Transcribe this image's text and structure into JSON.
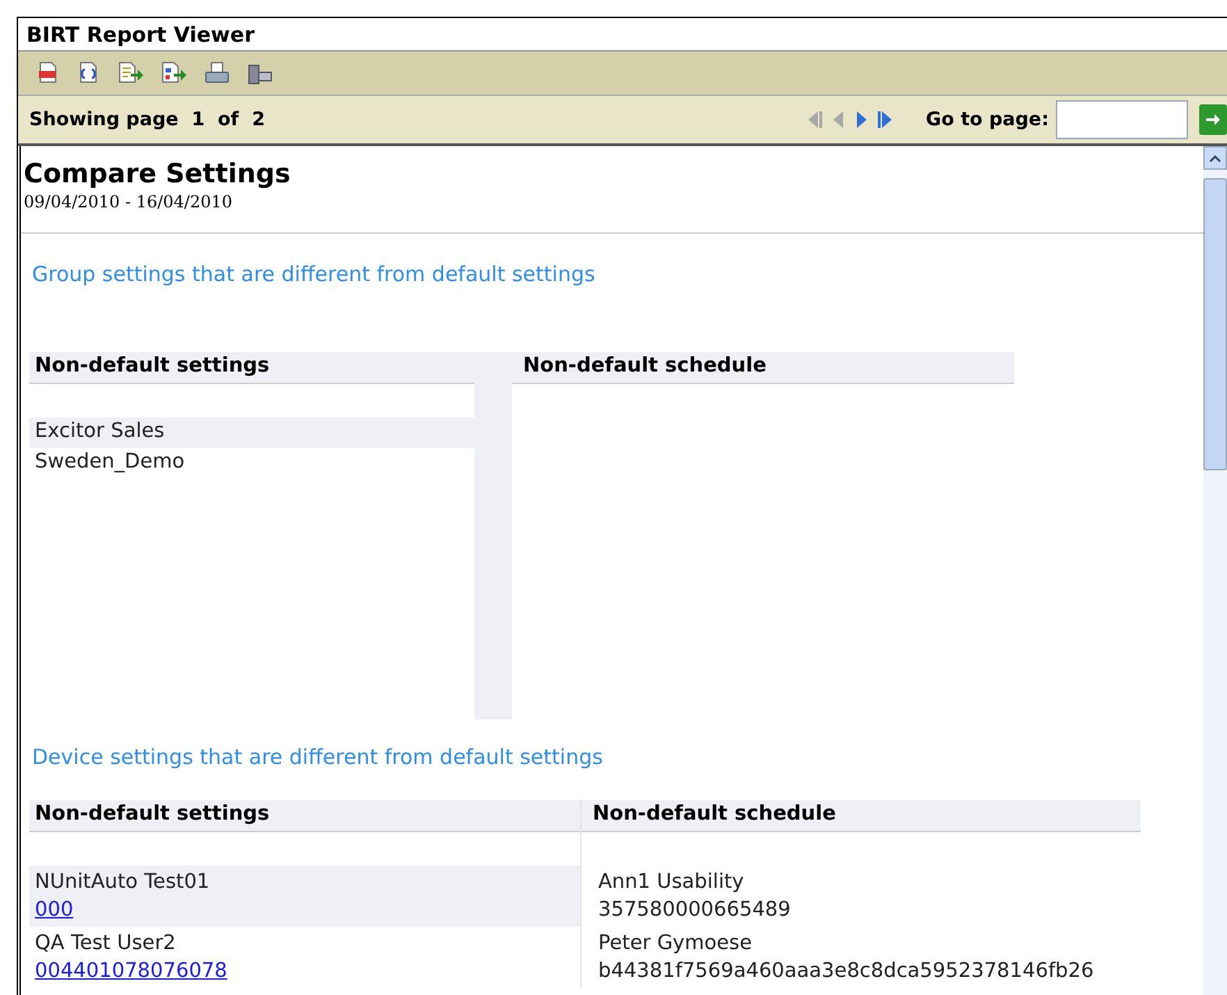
{
  "window": {
    "title": "BIRT Report Viewer"
  },
  "toolbar": [
    {
      "kind": "toc"
    },
    {
      "kind": "parameters"
    },
    {
      "kind": "export-data"
    },
    {
      "kind": "export-report"
    },
    {
      "kind": "print"
    },
    {
      "kind": "print-server"
    }
  ],
  "navigation": {
    "showing": "Showing page",
    "page": "1",
    "of": "of",
    "total": "2",
    "buttons": [
      {
        "kind": "first",
        "disabled": true
      },
      {
        "kind": "previous",
        "disabled": true
      },
      {
        "kind": "next",
        "disabled": false
      },
      {
        "kind": "last",
        "disabled": false
      }
    ],
    "goto_label": "Go to page:"
  },
  "report": {
    "title": "Compare Settings",
    "dates": "09/04/2010 - 16/04/2010",
    "sections": [
      {
        "heading": "Group settings that are different from default settings",
        "kind": "group",
        "columns": [
          "Non-default settings",
          "Non-default schedule"
        ],
        "rows": [
          {
            "cells": [
              {
                "lines": [
                  {
                    "text": "Excitor Sales",
                    "link": false
                  }
                ]
              }
            ]
          },
          {
            "cells": [
              {
                "lines": [
                  {
                    "text": "Sweden_Demo",
                    "link": false
                  }
                ]
              }
            ]
          }
        ]
      },
      {
        "heading": "Device settings that are different from default settings",
        "kind": "device",
        "columns": [
          "Non-default settings",
          "Non-default schedule"
        ],
        "rows": [
          {
            "cells": [
              {
                "lines": [
                  {
                    "text": "NUnitAuto Test01",
                    "link": false
                  },
                  {
                    "text": "000",
                    "link": true
                  }
                ]
              },
              {
                "lines": [
                  {
                    "text": "Ann1 Usability",
                    "link": false
                  },
                  {
                    "text": "357580000665489",
                    "link": false
                  }
                ]
              }
            ]
          },
          {
            "cells": [
              {
                "lines": [
                  {
                    "text": "QA Test User2",
                    "link": false
                  },
                  {
                    "text": "004401078076078",
                    "link": true
                  }
                ]
              },
              {
                "lines": [
                  {
                    "text": "Peter Gymoese",
                    "link": false
                  },
                  {
                    "text": "b44381f7569a460aaa3e8c8dca5952378146fb26",
                    "link": false
                  }
                ]
              }
            ]
          }
        ]
      }
    ]
  }
}
